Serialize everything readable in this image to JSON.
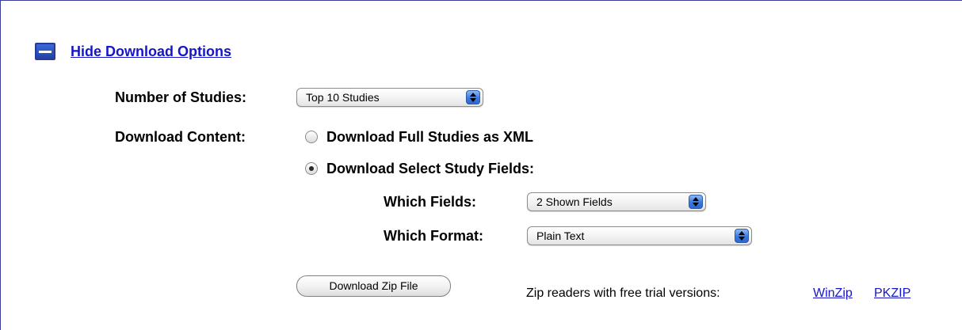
{
  "toggle": {
    "label": "Hide Download Options",
    "icon": "minus-icon"
  },
  "studies": {
    "label": "Number of Studies:",
    "selected": "Top 10 Studies"
  },
  "content": {
    "label": "Download Content:",
    "options": [
      {
        "label": "Download Full Studies as XML",
        "checked": false
      },
      {
        "label": "Download Select Study Fields:",
        "checked": true
      }
    ]
  },
  "fields": {
    "label": "Which Fields:",
    "selected": "2 Shown Fields"
  },
  "format": {
    "label": "Which Format:",
    "selected": "Plain Text"
  },
  "download_button": {
    "label": "Download Zip File"
  },
  "zip": {
    "text": "Zip readers with free trial versions:",
    "links": [
      "WinZip",
      "PKZIP"
    ]
  },
  "colors": {
    "link": "#1515c9",
    "frame_border": "#3c3c9a",
    "accent": "#3b69d8"
  }
}
